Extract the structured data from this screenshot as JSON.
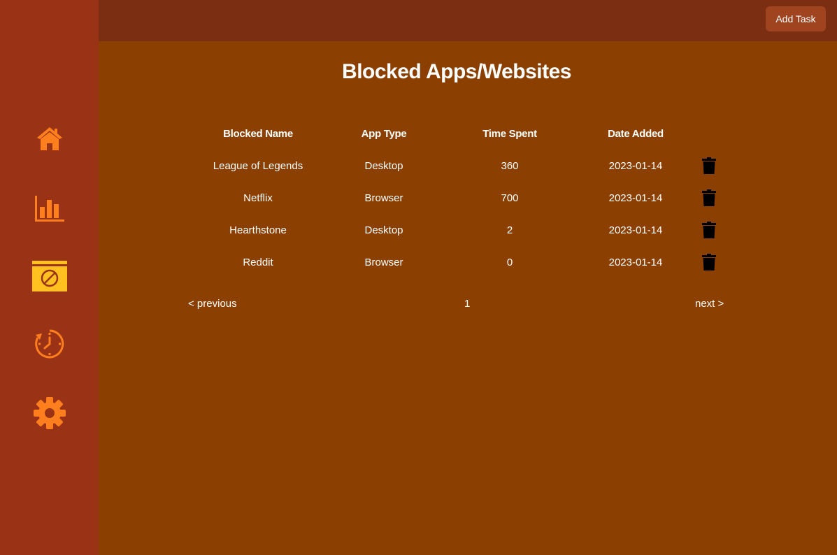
{
  "sidebar": {
    "items": [
      {
        "icon": "home-icon",
        "active": false
      },
      {
        "icon": "bar-chart-icon",
        "active": false
      },
      {
        "icon": "blocked-window-icon",
        "active": true
      },
      {
        "icon": "timer-icon",
        "active": false
      },
      {
        "icon": "gear-icon",
        "active": false
      }
    ]
  },
  "header": {
    "add_task_label": "Add Task"
  },
  "main": {
    "title": "Blocked Apps/Websites",
    "table": {
      "columns": [
        "Blocked Name",
        "App Type",
        "Time Spent",
        "Date Added"
      ],
      "rows": [
        {
          "name": "League of Legends",
          "type": "Desktop",
          "time": "360",
          "date": "2023-01-14",
          "action_icon": "trash-icon"
        },
        {
          "name": "Netflix",
          "type": "Browser",
          "time": "700",
          "date": "2023-01-14",
          "action_icon": "trash-icon"
        },
        {
          "name": "Hearthstone",
          "type": "Desktop",
          "time": "2",
          "date": "2023-01-14",
          "action_icon": "trash-icon"
        },
        {
          "name": "Reddit",
          "type": "Browser",
          "time": "0",
          "date": "2023-01-14",
          "action_icon": "trash-icon"
        }
      ]
    },
    "pagination": {
      "previous_label": "< previous",
      "current_page": "1",
      "next_label": "next >"
    }
  },
  "colors": {
    "background": "#8b3f00",
    "sidebar": "#9a3216",
    "topbar": "#7c2e13",
    "icon": "#ff7f1f",
    "active_icon": "#ffc020",
    "button": "#a0441f"
  }
}
